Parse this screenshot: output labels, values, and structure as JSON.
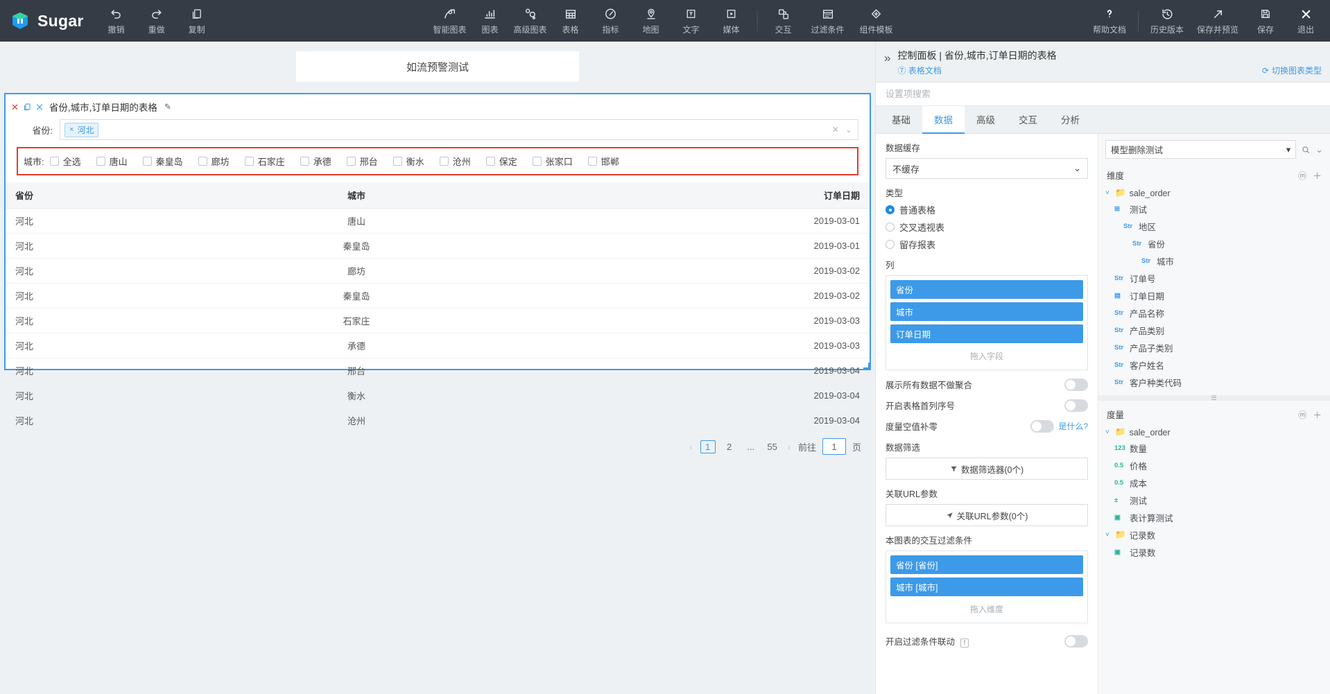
{
  "app": {
    "brand": "Sugar",
    "history_tools": [
      {
        "label": "撤销",
        "icon": "undo-icon"
      },
      {
        "label": "重做",
        "icon": "redo-icon"
      },
      {
        "label": "复制",
        "icon": "copy-icon"
      }
    ],
    "center_tools": [
      {
        "label": "智能图表",
        "icon": "smart-chart-icon"
      },
      {
        "label": "图表",
        "icon": "bar-chart-icon"
      },
      {
        "label": "高级图表",
        "icon": "advanced-chart-icon"
      },
      {
        "label": "表格",
        "icon": "table-icon"
      },
      {
        "label": "指标",
        "icon": "gauge-icon"
      },
      {
        "label": "地图",
        "icon": "map-pin-icon"
      },
      {
        "label": "文字",
        "icon": "text-icon"
      },
      {
        "label": "媒体",
        "icon": "media-icon"
      }
    ],
    "center_tools_2": [
      {
        "label": "交互",
        "icon": "interaction-icon"
      },
      {
        "label": "过滤条件",
        "icon": "filter-panel-icon"
      },
      {
        "label": "组件模板",
        "icon": "component-template-icon"
      }
    ],
    "right_tools_help": [
      {
        "label": "帮助文档",
        "icon": "question-icon"
      }
    ],
    "right_tools": [
      {
        "label": "历史版本",
        "icon": "history-icon"
      },
      {
        "label": "保存并预览",
        "icon": "expand-arrow-icon"
      },
      {
        "label": "保存",
        "icon": "save-icon"
      },
      {
        "label": "退出",
        "icon": "close-icon"
      }
    ]
  },
  "canvas": {
    "dashboard_title": "如流预警测试",
    "widget": {
      "title": "省份,城市,订单日期的表格",
      "province_filter": {
        "label": "省份:",
        "tags": [
          "河北"
        ]
      },
      "city_filter": {
        "label": "城市:",
        "options": [
          "全选",
          "唐山",
          "秦皇岛",
          "廊坊",
          "石家庄",
          "承德",
          "邢台",
          "衡水",
          "沧州",
          "保定",
          "张家口",
          "邯郸"
        ]
      },
      "table": {
        "columns": [
          "省份",
          "城市",
          "订单日期"
        ],
        "rows": [
          [
            "河北",
            "唐山",
            "2019-03-01"
          ],
          [
            "河北",
            "秦皇岛",
            "2019-03-01"
          ],
          [
            "河北",
            "廊坊",
            "2019-03-02"
          ],
          [
            "河北",
            "秦皇岛",
            "2019-03-02"
          ],
          [
            "河北",
            "石家庄",
            "2019-03-03"
          ],
          [
            "河北",
            "承德",
            "2019-03-03"
          ],
          [
            "河北",
            "邢台",
            "2019-03-04"
          ],
          [
            "河北",
            "衡水",
            "2019-03-04"
          ],
          [
            "河北",
            "沧州",
            "2019-03-04"
          ]
        ]
      },
      "pagination": {
        "prev": "‹",
        "pages": [
          "1",
          "2",
          "...",
          "55"
        ],
        "current": "1",
        "next": "›",
        "goto_label": "前往",
        "goto_value": "1",
        "page_unit": "页"
      }
    }
  },
  "panel": {
    "breadcrumb": "控制面板 | 省份,城市,订单日期的表格",
    "doc_link": "表格文档",
    "switch_chart_type": "切换图表类型",
    "search_placeholder": "设置项搜索",
    "tabs": [
      {
        "label": "基础",
        "active": false
      },
      {
        "label": "数据",
        "active": true
      },
      {
        "label": "高级",
        "active": false
      },
      {
        "label": "交互",
        "active": false
      },
      {
        "label": "分析",
        "active": false
      }
    ],
    "data_cache": {
      "label": "数据缓存",
      "value": "不缓存"
    },
    "type": {
      "label": "类型",
      "options": [
        {
          "label": "普通表格",
          "selected": true
        },
        {
          "label": "交叉透视表",
          "selected": false
        },
        {
          "label": "留存报表",
          "selected": false
        }
      ]
    },
    "columns": {
      "label": "列",
      "fields": [
        "省份",
        "城市",
        "订单日期"
      ],
      "drop_hint": "拖入字段"
    },
    "toggles": [
      {
        "label": "展示所有数据不做聚合",
        "on": false
      },
      {
        "label": "开启表格首列序号",
        "on": false
      }
    ],
    "zero_fill": {
      "label": "度量空值补零",
      "on": false,
      "help": "是什么?"
    },
    "data_filter": {
      "label": "数据筛选",
      "button": "数据筛选器(0个)",
      "icon": "funnel-icon"
    },
    "url_params": {
      "label": "关联URL参数",
      "button": "关联URL参数(0个)",
      "icon": "send-icon"
    },
    "interactive_filters": {
      "label": "本图表的交互过滤条件",
      "fields": [
        "省份 [省份]",
        "城市 [城市]"
      ],
      "drop_hint": "拖入维度"
    },
    "filter_linkage": {
      "label": "开启过滤条件联动",
      "badge": "!",
      "on": false
    },
    "dataset": {
      "name": "模型删除测试",
      "search_icon": "search-icon",
      "chevron_icon": "chevron-down-icon"
    },
    "dimensions": {
      "title": "维度",
      "tree": [
        {
          "label": "sale_order",
          "kind": "folder",
          "indent": 0,
          "caret": "˅"
        },
        {
          "label": "测试",
          "kind": "hierarchy",
          "indent": 1,
          "type": ""
        },
        {
          "label": "地区",
          "kind": "field",
          "indent": 2,
          "type": "Str"
        },
        {
          "label": "省份",
          "kind": "field",
          "indent": 3,
          "type": "Str"
        },
        {
          "label": "城市",
          "kind": "field",
          "indent": 4,
          "type": "Str"
        },
        {
          "label": "订单号",
          "kind": "field",
          "indent": 1,
          "type": "Str"
        },
        {
          "label": "订单日期",
          "kind": "date",
          "indent": 1,
          "type": ""
        },
        {
          "label": "产品名称",
          "kind": "field",
          "indent": 1,
          "type": "Str"
        },
        {
          "label": "产品类别",
          "kind": "field",
          "indent": 1,
          "type": "Str"
        },
        {
          "label": "产品子类别",
          "kind": "field",
          "indent": 1,
          "type": "Str"
        },
        {
          "label": "客户姓名",
          "kind": "field",
          "indent": 1,
          "type": "Str"
        },
        {
          "label": "客户种类代码",
          "kind": "field",
          "indent": 1,
          "type": "Str"
        }
      ]
    },
    "measures": {
      "title": "度量",
      "tree": [
        {
          "label": "sale_order",
          "kind": "folder",
          "indent": 0,
          "caret": "˅"
        },
        {
          "label": "数量",
          "kind": "field",
          "indent": 1,
          "type": "123"
        },
        {
          "label": "价格",
          "kind": "field",
          "indent": 1,
          "type": "0.5"
        },
        {
          "label": "成本",
          "kind": "field",
          "indent": 1,
          "type": "0.5"
        },
        {
          "label": "测试",
          "kind": "calc",
          "indent": 1,
          "type": ""
        },
        {
          "label": "表计算测试",
          "kind": "tablecalc",
          "indent": 1,
          "type": ""
        },
        {
          "label": "记录数",
          "kind": "folder",
          "indent": 0,
          "caret": "˅"
        },
        {
          "label": "记录数",
          "kind": "tablecalc",
          "indent": 1,
          "type": ""
        }
      ]
    }
  },
  "colors": {
    "topbar": "#353c46",
    "accent": "#3d9ae8",
    "alert_border": "#e8392c",
    "folder_green": "#3fbf8f"
  }
}
